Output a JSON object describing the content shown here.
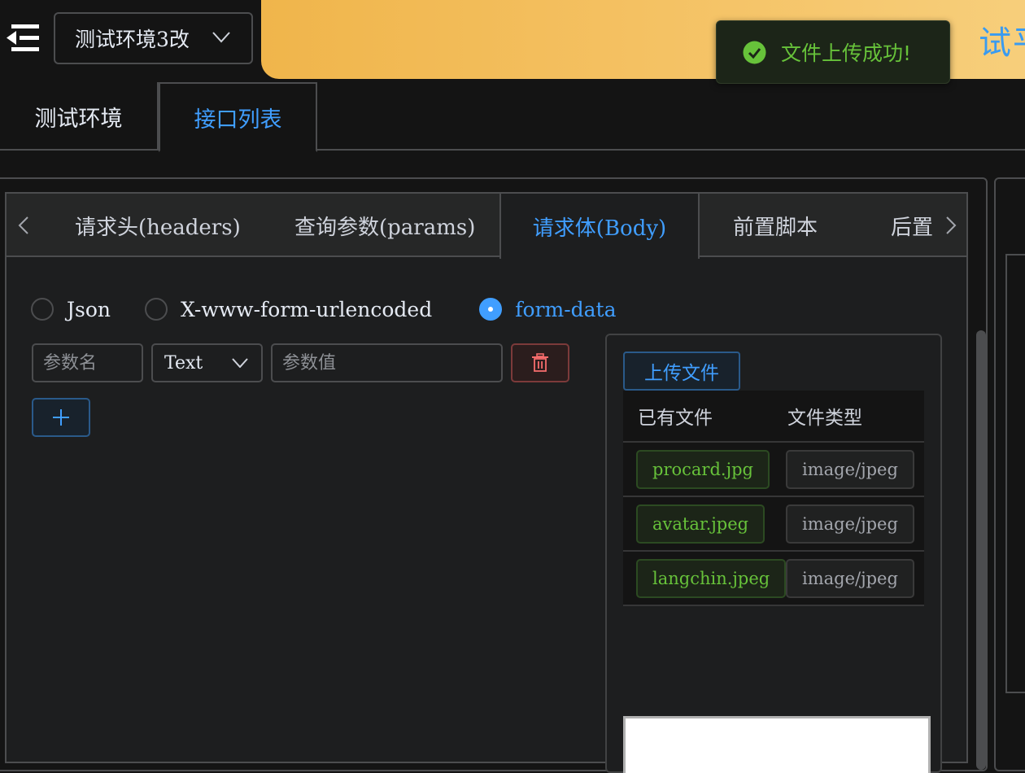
{
  "header": {
    "env_select": "测试环境3改",
    "banner_title": "试平"
  },
  "toast": {
    "message": "文件上传成功!"
  },
  "top_tabs": [
    {
      "label": "测试环境",
      "active": false
    },
    {
      "label": "接口列表",
      "active": true
    }
  ],
  "sub_tabs": [
    {
      "label": "请求头(headers)",
      "active": false
    },
    {
      "label": "查询参数(params)",
      "active": false
    },
    {
      "label": "请求体(Body)",
      "active": true
    },
    {
      "label": "前置脚本",
      "active": false
    },
    {
      "label": "后置",
      "active": false
    }
  ],
  "body_types": [
    {
      "label": "Json",
      "checked": false
    },
    {
      "label": "X-www-form-urlencoded",
      "checked": false
    },
    {
      "label": "form-data",
      "checked": true
    }
  ],
  "param_row": {
    "name_placeholder": "参数名",
    "type_value": "Text",
    "value_placeholder": "参数值"
  },
  "upload": {
    "button_label": "上传文件",
    "columns": [
      "已有文件",
      "文件类型"
    ],
    "files": [
      {
        "name": "procard.jpg",
        "type": "image/jpeg"
      },
      {
        "name": "avatar.jpeg",
        "type": "image/jpeg"
      },
      {
        "name": "langchin.jpeg",
        "type": "image/jpeg"
      }
    ]
  },
  "colors": {
    "accent": "#409eff",
    "success": "#67c23a",
    "danger": "#f56c6c",
    "banner": "#f0b54b"
  }
}
